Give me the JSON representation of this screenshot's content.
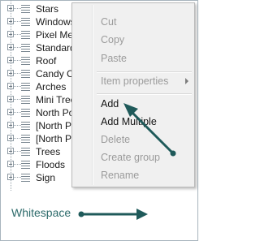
{
  "tree": {
    "nodes": [
      {
        "label": "Stars"
      },
      {
        "label": "Windows"
      },
      {
        "label": "Pixel Meg"
      },
      {
        "label": "Standard"
      },
      {
        "label": "Roof"
      },
      {
        "label": "Candy Ca"
      },
      {
        "label": "Arches"
      },
      {
        "label": "Mini Trees"
      },
      {
        "label": "North Pol"
      },
      {
        "label": "[North Po"
      },
      {
        "label": "[North Po"
      },
      {
        "label": "Trees"
      },
      {
        "label": "Floods"
      },
      {
        "label": "Sign"
      }
    ]
  },
  "context_menu": {
    "items": [
      {
        "label": "Cut",
        "enabled": false
      },
      {
        "label": "Copy",
        "enabled": false
      },
      {
        "label": "Paste",
        "enabled": false
      },
      {
        "label": "Item properties",
        "enabled": false,
        "submenu": true
      },
      {
        "label": "Add",
        "enabled": true
      },
      {
        "label": "Add Multiple",
        "enabled": true
      },
      {
        "label": "Delete",
        "enabled": false
      },
      {
        "label": "Create group",
        "enabled": false
      },
      {
        "label": "Rename",
        "enabled": false
      }
    ]
  },
  "annotation": {
    "whitespace_label": "Whitespace",
    "arrow_color": "#1f5a5a"
  },
  "colors": {
    "menu_background": "#f0f0f0",
    "disabled_text": "#9b9b9b",
    "annotation_text": "#2d6b6b"
  }
}
